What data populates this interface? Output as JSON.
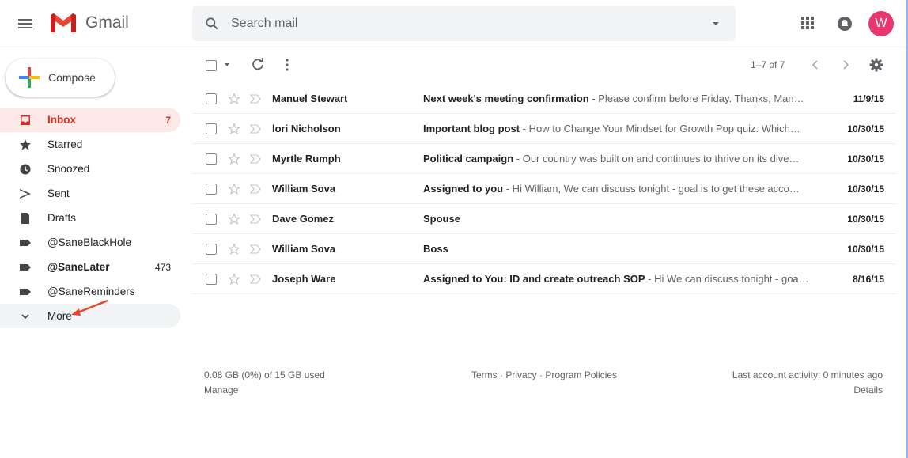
{
  "app": {
    "name": "Gmail"
  },
  "search": {
    "placeholder": "Search mail"
  },
  "account": {
    "initial": "W",
    "color": "#e8376f"
  },
  "compose": {
    "label": "Compose"
  },
  "sidebar": {
    "items": [
      {
        "label": "Inbox",
        "count": "7",
        "icon": "inbox-icon"
      },
      {
        "label": "Starred",
        "count": "",
        "icon": "star-icon"
      },
      {
        "label": "Snoozed",
        "count": "",
        "icon": "clock-icon"
      },
      {
        "label": "Sent",
        "count": "",
        "icon": "send-icon"
      },
      {
        "label": "Drafts",
        "count": "",
        "icon": "file-icon"
      },
      {
        "label": "@SaneBlackHole",
        "count": "",
        "icon": "label-icon"
      },
      {
        "label": "@SaneLater",
        "count": "473",
        "icon": "label-icon"
      },
      {
        "label": "@SaneReminders",
        "count": "",
        "icon": "label-icon"
      },
      {
        "label": "More",
        "count": "",
        "icon": "chevron-down-icon"
      }
    ]
  },
  "toolbar": {
    "pagination": "1–7 of 7"
  },
  "emails": [
    {
      "sender": "Manuel Stewart",
      "subject": "Next week's meeting confirmation",
      "snippet": " - Please confirm before Friday. Thanks, Man…",
      "date": "11/9/15"
    },
    {
      "sender": "lori Nicholson",
      "subject": "Important blog post",
      "snippet": " - How to Change Your Mindset for Growth Pop quiz. Which…",
      "date": "10/30/15"
    },
    {
      "sender": "Myrtle Rumph",
      "subject": "Political campaign",
      "snippet": " - Our country was built on and continues to thrive on its dive…",
      "date": "10/30/15"
    },
    {
      "sender": "William Sova",
      "subject": "Assigned to you",
      "snippet": " - Hi William, We can discuss tonight - goal is to get these acco…",
      "date": "10/30/15"
    },
    {
      "sender": "Dave Gomez",
      "subject": "Spouse",
      "snippet": "",
      "date": "10/30/15"
    },
    {
      "sender": "William Sova",
      "subject": "Boss",
      "snippet": "",
      "date": "10/30/15"
    },
    {
      "sender": "Joseph Ware",
      "subject": "Assigned to You: ID and create outreach SOP",
      "snippet": " - Hi We can discuss tonight - goa…",
      "date": "8/16/15"
    }
  ],
  "footer": {
    "storage": "0.08 GB (0%) of 15 GB used",
    "manage": "Manage",
    "terms": "Terms",
    "privacy": "Privacy",
    "policies": "Program Policies",
    "sep": " · ",
    "activity": "Last account activity: 0 minutes ago",
    "details": "Details"
  },
  "colors": {
    "accent": "#d93025",
    "active_bg": "#fce8e6",
    "annotation": "#e8452c"
  }
}
